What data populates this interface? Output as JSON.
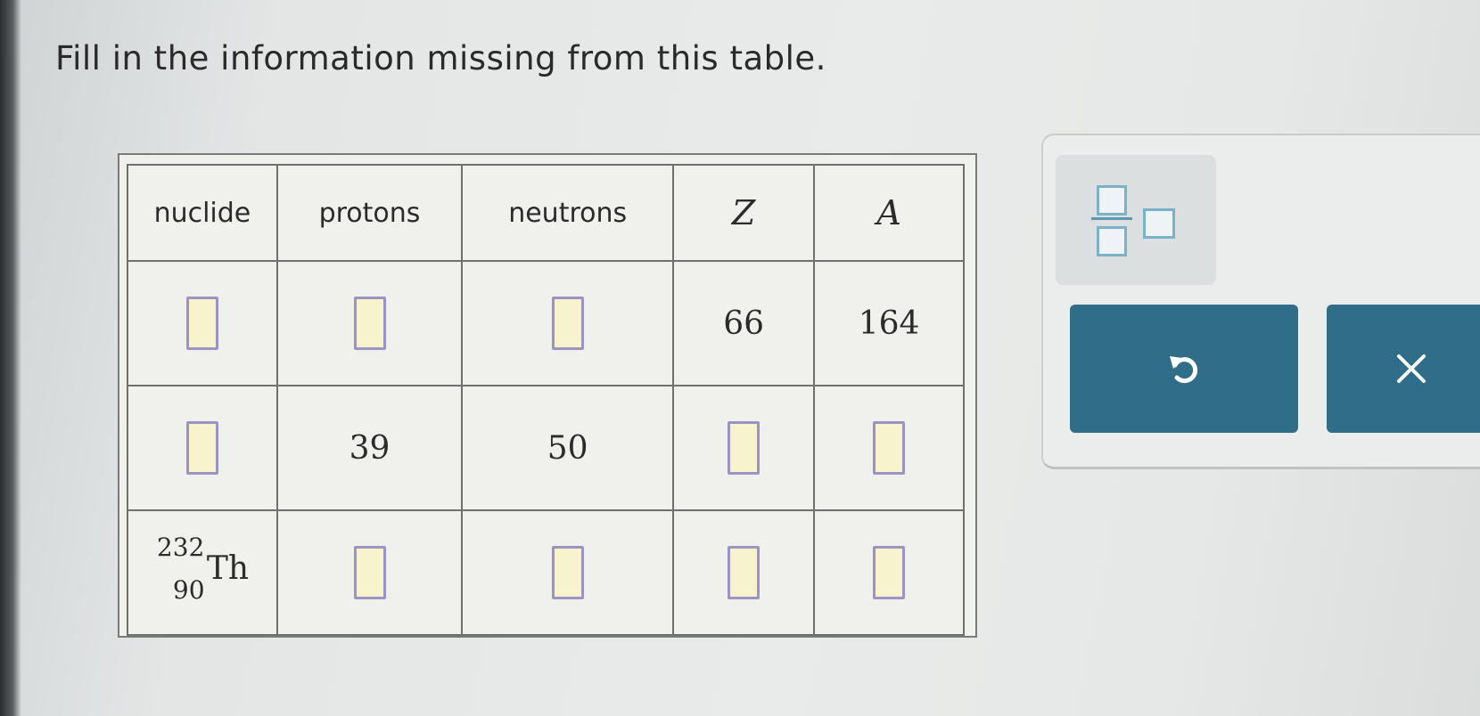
{
  "prompt": "Fill in the information missing from this table.",
  "table": {
    "headers": [
      "nuclide",
      "protons",
      "neutrons",
      "Z",
      "A"
    ],
    "rows": [
      {
        "nuclide": "",
        "protons": "",
        "neutrons": "",
        "Z": "66",
        "A": "164"
      },
      {
        "nuclide": "",
        "protons": "39",
        "neutrons": "50",
        "Z": "",
        "A": ""
      },
      {
        "nuclide": {
          "mass": "232",
          "atomic": "90",
          "symbol": "Th"
        },
        "protons": "",
        "neutrons": "",
        "Z": "",
        "A": ""
      }
    ]
  },
  "tools": {
    "fraction_icon": "fraction-template-icon",
    "undo_icon": "undo-icon",
    "clear_icon": "close-icon"
  },
  "colors": {
    "button_bg": "#2f6d88",
    "answer_box_fill": "#f7f3cc",
    "answer_box_border": "#9a94c4",
    "fraction_box_border": "#7bb2cb"
  }
}
